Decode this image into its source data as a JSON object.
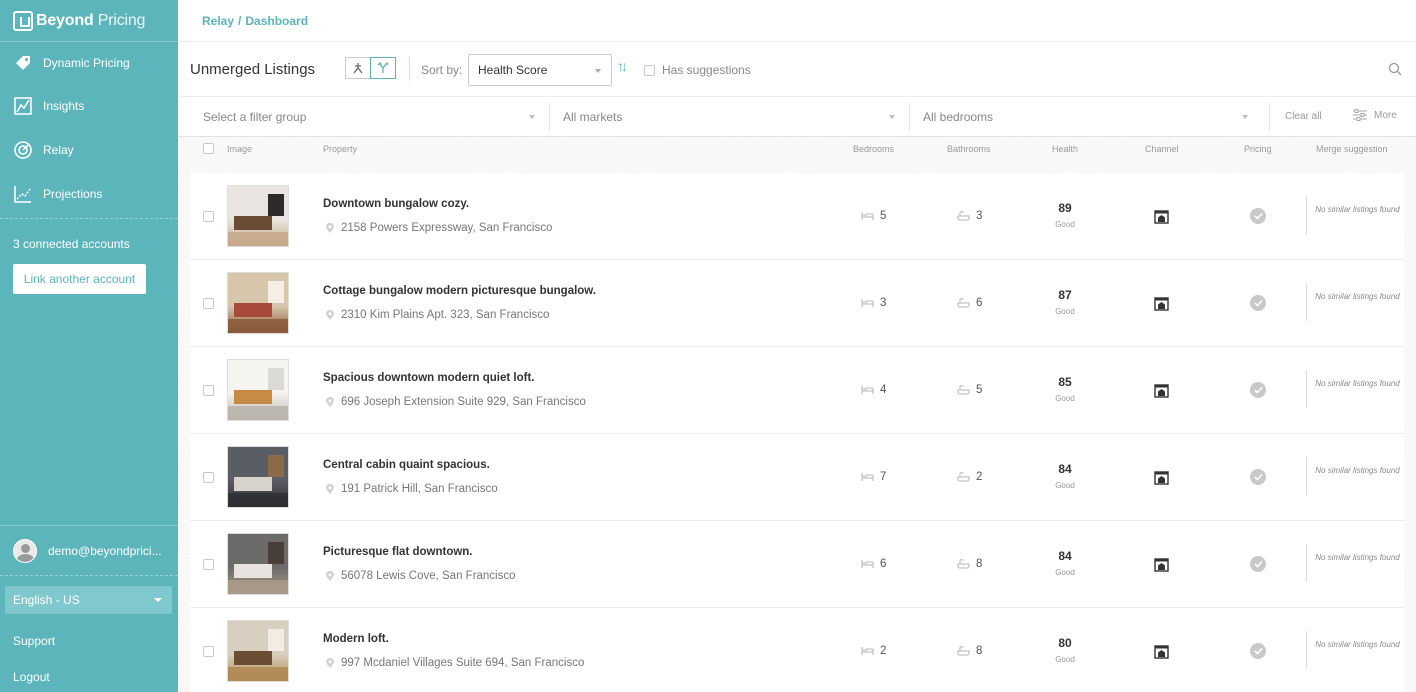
{
  "brand": {
    "name_bold": "Beyond",
    "name_light": "Pricing"
  },
  "sidebar": {
    "nav": [
      {
        "label": "Dynamic Pricing",
        "icon": "tag-icon"
      },
      {
        "label": "Insights",
        "icon": "chart-icon"
      },
      {
        "label": "Relay",
        "icon": "relay-icon"
      },
      {
        "label": "Projections",
        "icon": "projections-icon"
      }
    ],
    "accounts_text": "3 connected accounts",
    "link_account_label": "Link another account",
    "user_email": "demo@beyondprici...",
    "language": "English - US",
    "support_label": "Support",
    "logout_label": "Logout"
  },
  "breadcrumb": {
    "section": "Relay",
    "separator": "/",
    "page": "Dashboard"
  },
  "toolbar": {
    "title": "Unmerged Listings",
    "sort_label": "Sort by:",
    "sort_value": "Health Score",
    "suggestions_label": "Has suggestions"
  },
  "filters": {
    "group_placeholder": "Select a filter group",
    "markets": "All markets",
    "bedrooms": "All bedrooms",
    "clear_all": "Clear all",
    "more": "More"
  },
  "table": {
    "headers": {
      "image": "Image",
      "property": "Property",
      "bedrooms": "Bedrooms",
      "bathrooms": "Bathrooms",
      "health": "Health",
      "channel": "Channel",
      "pricing": "Pricing",
      "merge": "Merge suggestion"
    },
    "rows": [
      {
        "name": "Downtown bungalow cozy.",
        "address": "2158 Powers Expressway, San Francisco",
        "bedrooms": "5",
        "bathrooms": "3",
        "health": "89",
        "health_label": "Good",
        "merge": "No similar listings found",
        "thumb": [
          "#e9e6e1",
          "#6b4b33",
          "#2c2a2a",
          "#c7a98a"
        ]
      },
      {
        "name": "Cottage bungalow modern picturesque bungalow.",
        "address": "2310 Kim Plains Apt. 323, San Francisco",
        "bedrooms": "3",
        "bathrooms": "6",
        "health": "87",
        "health_label": "Good",
        "merge": "No similar listings found",
        "thumb": [
          "#d7c6ac",
          "#a84a3a",
          "#f4eee3",
          "#8a5a3a"
        ]
      },
      {
        "name": "Spacious downtown modern quiet loft.",
        "address": "696 Joseph Extension Suite 929, San Francisco",
        "bedrooms": "4",
        "bathrooms": "5",
        "health": "85",
        "health_label": "Good",
        "merge": "No similar listings found",
        "thumb": [
          "#f6f4f1",
          "#c88b45",
          "#dcdad6",
          "#b9b4ac"
        ]
      },
      {
        "name": "Central cabin quaint spacious.",
        "address": "191 Patrick Hill, San Francisco",
        "bedrooms": "7",
        "bathrooms": "2",
        "health": "84",
        "health_label": "Good",
        "merge": "No similar listings found",
        "thumb": [
          "#5a5d63",
          "#d8d4cd",
          "#8b6b4a",
          "#2e2f33"
        ]
      },
      {
        "name": "Picturesque flat downtown.",
        "address": "56078 Lewis Cove, San Francisco",
        "bedrooms": "6",
        "bathrooms": "8",
        "health": "84",
        "health_label": "Good",
        "merge": "No similar listings found",
        "thumb": [
          "#6d6b69",
          "#e7e4df",
          "#4a3f38",
          "#a99b8a"
        ]
      },
      {
        "name": "Modern loft.",
        "address": "997 Mcdaniel Villages Suite 694, San Francisco",
        "bedrooms": "2",
        "bathrooms": "8",
        "health": "80",
        "health_label": "Good",
        "merge": "No similar listings found",
        "thumb": [
          "#d9cfc0",
          "#6a4e33",
          "#f1ece4",
          "#b08a55"
        ]
      }
    ]
  },
  "colors": {
    "accent": "#5bb5bb",
    "sidebar_bg": "#5bb5bb"
  }
}
